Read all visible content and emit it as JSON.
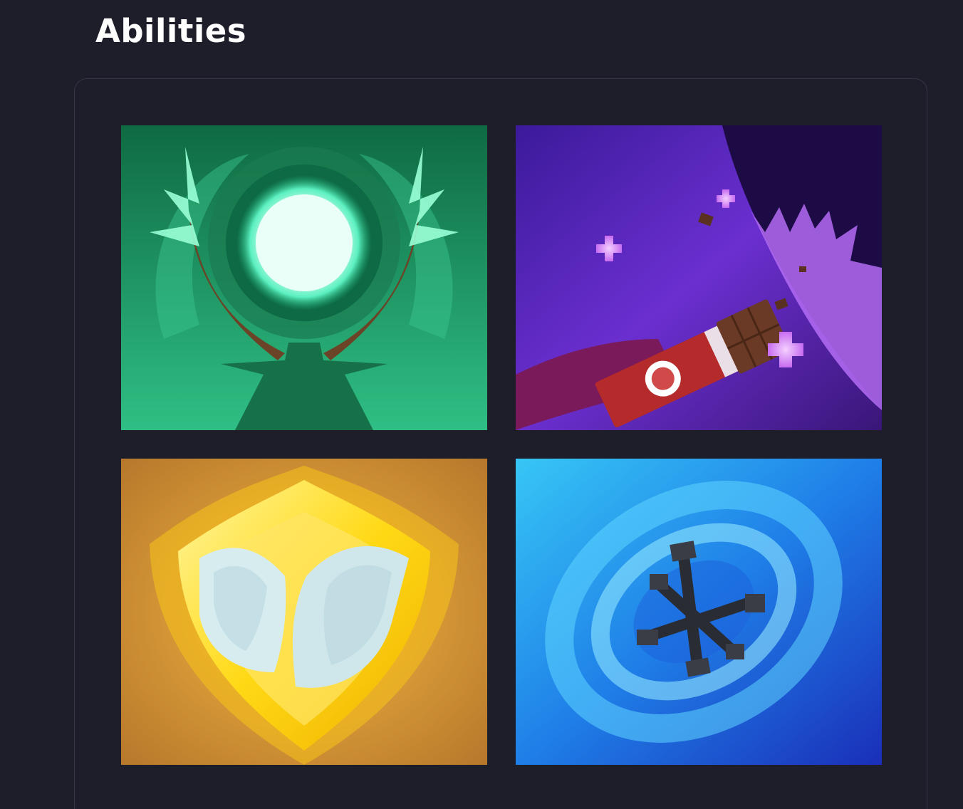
{
  "section": {
    "title": "Abilities"
  },
  "abilities": [
    {
      "icon": "spirit-antlers-orb-icon",
      "accent": "#2fbf84"
    },
    {
      "icon": "chocolate-bar-icon",
      "accent": "#8a3fd8"
    },
    {
      "icon": "winged-shield-icon",
      "accent": "#f4c20d"
    },
    {
      "icon": "spinning-caltrop-icon",
      "accent": "#2f8be8"
    }
  ]
}
